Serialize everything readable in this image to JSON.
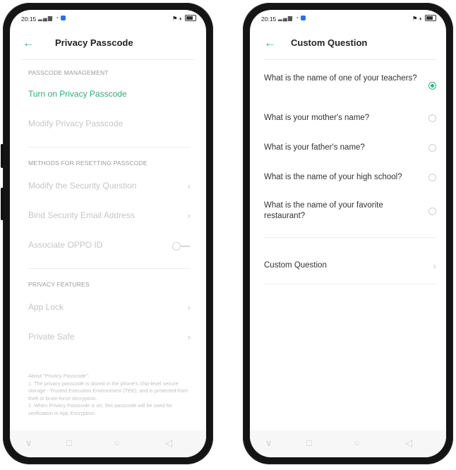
{
  "left_phone": {
    "status": {
      "time": "20:15",
      "right": "⚑ ◐"
    },
    "header": {
      "back_icon": "←",
      "title": "Privacy Passcode"
    },
    "sections": {
      "management": "PASSCODE MANAGEMENT",
      "resetting": "METHODS FOR RESETTING PASSCODE",
      "features": "PRIVACY FEATURES"
    },
    "items": {
      "turn_on": "Turn on Privacy Passcode",
      "modify": "Modify Privacy Passcode",
      "security_question": "Modify the Security Question",
      "bind_email": "Bind Security Email Address",
      "associate_id": "Associate OPPO ID",
      "app_lock": "App Lock",
      "private_safe": "Private Safe"
    },
    "about": [
      "About \"Privacy Passcode\":",
      "1. The privacy passcode is stored in the phone's chip-level secure storage - Trusted Execution Environment (TEE), and is protected from theft or brute-force decryption.",
      "2. When Privacy Passcode is on, this passcode will be used for verification in App Encryption."
    ],
    "chevron": "›"
  },
  "right_phone": {
    "status": {
      "time": "20:15",
      "right": "⚑ ◐"
    },
    "header": {
      "back_icon": "←",
      "title": "Custom Question"
    },
    "questions": [
      {
        "text": "What is the name of one of your teachers?",
        "selected": true
      },
      {
        "text": "What is your mother's name?",
        "selected": false
      },
      {
        "text": "What is your father's name?",
        "selected": false
      },
      {
        "text": "What is the name of your high school?",
        "selected": false
      },
      {
        "text": "What is the name of your favorite restaurant?",
        "selected": false
      }
    ],
    "custom_question": "Custom Question",
    "chevron": "›"
  },
  "navbar": {
    "menu": "∨",
    "home_square": "□",
    "home_circle": "○",
    "back": "◁"
  },
  "colors": {
    "accent": "#2bb27a",
    "disabled": "#c6c6c6",
    "frame": "#141414"
  }
}
